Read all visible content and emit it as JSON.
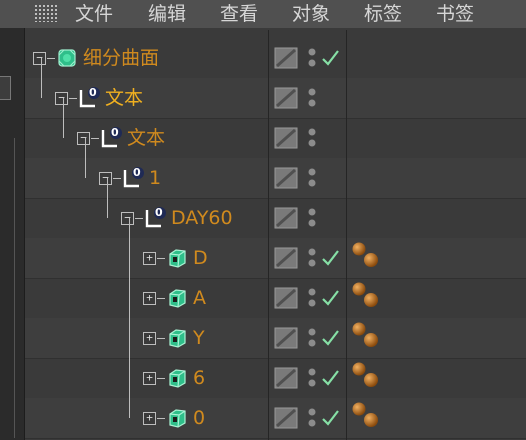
{
  "menu": [
    "文件",
    "编辑",
    "查看",
    "对象",
    "标签",
    "书签"
  ],
  "colors": {
    "name_text": "#d08a1e",
    "name_text_selected": "#f0b020",
    "check": "#86e0a6",
    "tag_ball": "#c8761a"
  },
  "objects": [
    {
      "name": "细分曲面",
      "icon": "subdivision-surface-icon",
      "depth": 0,
      "expander": "−",
      "check": true,
      "tag": false
    },
    {
      "name": "文本",
      "icon": "null-object-icon",
      "depth": 1,
      "expander": "−",
      "check": false,
      "tag": false
    },
    {
      "name": "文本",
      "icon": "null-object-icon",
      "depth": 2,
      "expander": "−",
      "check": false,
      "tag": false
    },
    {
      "name": "1",
      "icon": "null-object-icon",
      "depth": 3,
      "expander": "−",
      "check": false,
      "tag": false
    },
    {
      "name": "DAY60",
      "icon": "null-object-icon",
      "depth": 4,
      "expander": "−",
      "check": false,
      "tag": false
    },
    {
      "name": "D",
      "icon": "extrude-icon",
      "depth": 5,
      "expander": "+",
      "check": true,
      "tag": true
    },
    {
      "name": "A",
      "icon": "extrude-icon",
      "depth": 5,
      "expander": "+",
      "check": true,
      "tag": true
    },
    {
      "name": "Y",
      "icon": "extrude-icon",
      "depth": 5,
      "expander": "+",
      "check": true,
      "tag": true
    },
    {
      "name": "6",
      "icon": "extrude-icon",
      "depth": 5,
      "expander": "+",
      "check": true,
      "tag": true
    },
    {
      "name": "0",
      "icon": "extrude-icon",
      "depth": 5,
      "expander": "+",
      "check": true,
      "tag": true
    }
  ],
  "null_icon_badge": "0"
}
